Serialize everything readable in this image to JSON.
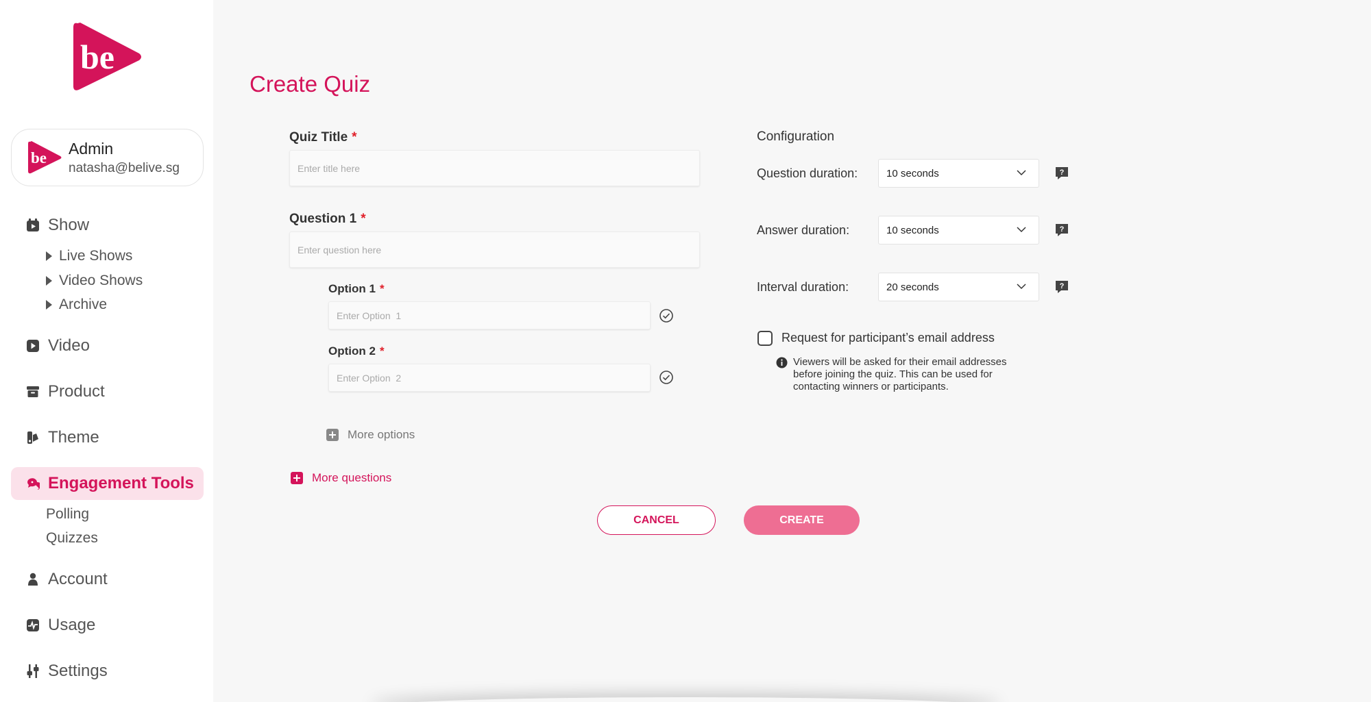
{
  "brand": {
    "logo_text": "be",
    "accent": "#d4145a"
  },
  "user": {
    "name": "Admin",
    "email": "natasha@belive.sg"
  },
  "nav": {
    "show": "Show",
    "show_sub": [
      "Live Shows",
      "Video Shows",
      "Archive"
    ],
    "video": "Video",
    "product": "Product",
    "theme": "Theme",
    "engagement": "Engagement Tools",
    "engagement_sub": [
      "Polling",
      "Quizzes"
    ],
    "account": "Account",
    "usage": "Usage",
    "settings": "Settings"
  },
  "page": {
    "title": "Create Quiz"
  },
  "form": {
    "quiz_title_label": "Quiz Title",
    "quiz_title_placeholder": "Enter title here",
    "question_label": "Question 1",
    "question_placeholder": "Enter question here",
    "option1_label": "Option 1",
    "option1_placeholder": "Enter Option  1",
    "option2_label": "Option 2",
    "option2_placeholder": "Enter Option  2",
    "more_options": "More options",
    "more_questions": "More questions",
    "required_mark": "*"
  },
  "config": {
    "heading": "Configuration",
    "question_duration_label": "Question duration:",
    "question_duration_value": "10 seconds",
    "answer_duration_label": "Answer duration:",
    "answer_duration_value": "10 seconds",
    "interval_duration_label": "Interval duration:",
    "interval_duration_value": "20 seconds",
    "email_checkbox_label": "Request for participant’s email address",
    "email_checkbox_checked": false,
    "email_info": "Viewers will be asked for their email addresses before joining the quiz. This can be used for contacting winners or participants."
  },
  "actions": {
    "cancel": "CANCEL",
    "create": "CREATE"
  },
  "icons": {
    "show": "calendar-play-icon",
    "video": "video-play-icon",
    "product": "archive-box-icon",
    "theme": "palette-icon",
    "engagement": "chat-bubbles-icon",
    "account": "person-icon",
    "usage": "activity-chart-icon",
    "settings": "sliders-icon"
  }
}
